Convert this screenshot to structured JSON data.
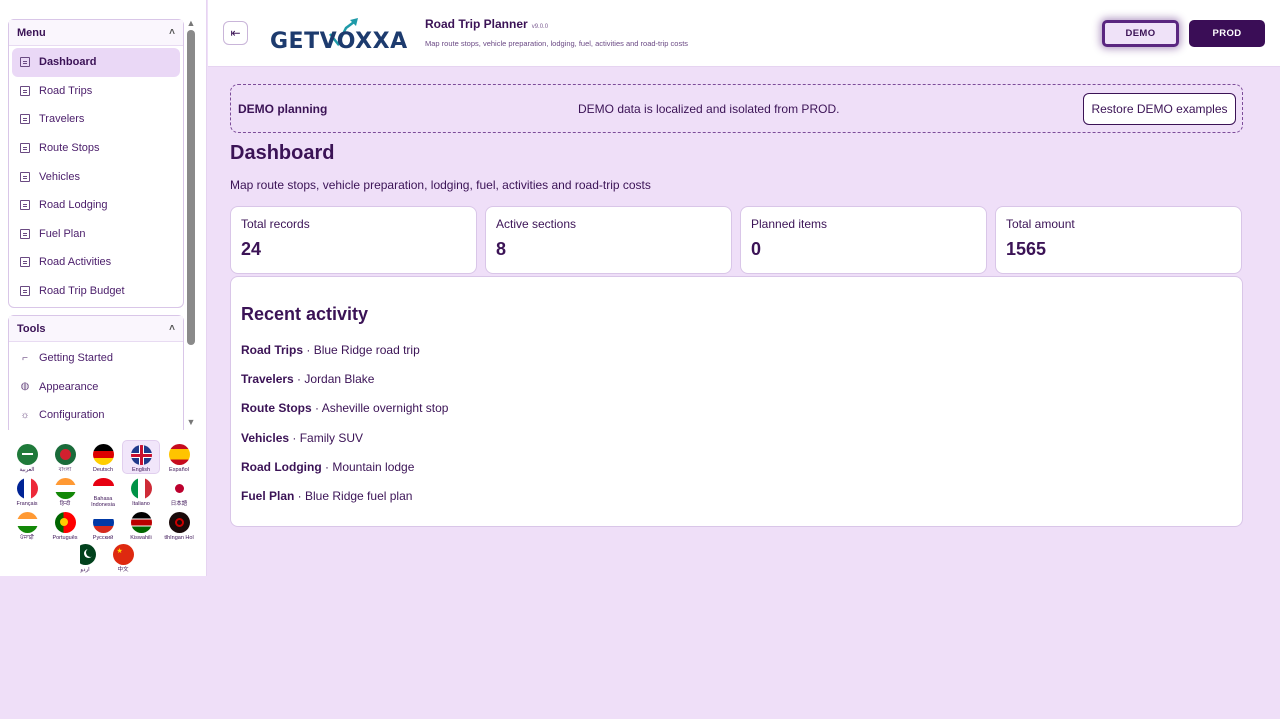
{
  "sidebar": {
    "menu": {
      "title": "Menu",
      "items": [
        {
          "label": "Dashboard",
          "active": true
        },
        {
          "label": "Road Trips"
        },
        {
          "label": "Travelers"
        },
        {
          "label": "Route Stops"
        },
        {
          "label": "Vehicles"
        },
        {
          "label": "Road Lodging"
        },
        {
          "label": "Fuel Plan"
        },
        {
          "label": "Road Activities"
        },
        {
          "label": "Road Trip Budget"
        }
      ]
    },
    "tools": {
      "title": "Tools",
      "items": [
        {
          "label": "Getting Started",
          "icon": "crop-icon"
        },
        {
          "label": "Appearance",
          "icon": "palette-icon"
        },
        {
          "label": "Configuration",
          "icon": "gear-icon"
        }
      ]
    },
    "languages": [
      {
        "label": "العربية",
        "flag": "saudi-arabia-flag-icon"
      },
      {
        "label": "বাংলা",
        "flag": "bangladesh-flag-icon"
      },
      {
        "label": "Deutsch",
        "flag": "germany-flag-icon"
      },
      {
        "label": "English",
        "flag": "uk-flag-icon",
        "active": true
      },
      {
        "label": "Español",
        "flag": "spain-flag-icon"
      },
      {
        "label": "Français",
        "flag": "france-flag-icon"
      },
      {
        "label": "हिन्दी",
        "flag": "india-flag-icon"
      },
      {
        "label": "Bahasa Indonesia",
        "flag": "indonesia-flag-icon"
      },
      {
        "label": "Italiano",
        "flag": "italy-flag-icon"
      },
      {
        "label": "日本語",
        "flag": "japan-flag-icon"
      },
      {
        "label": "ਪੰਜਾਬੀ",
        "flag": "india-flag-icon"
      },
      {
        "label": "Português",
        "flag": "portugal-flag-icon"
      },
      {
        "label": "Русский",
        "flag": "russia-flag-icon"
      },
      {
        "label": "Kiswahili",
        "flag": "kenya-flag-icon"
      },
      {
        "label": "tlhIngan Hol",
        "flag": "klingon-flag-icon"
      },
      {
        "label": "اردو",
        "flag": "pakistan-flag-icon"
      },
      {
        "label": "中文",
        "flag": "china-flag-icon"
      }
    ]
  },
  "header": {
    "logo_text": "GETVOXXA",
    "app_title": "Road Trip Planner",
    "version": "v9.0.0",
    "subtitle": "Map route stops, vehicle preparation, lodging, fuel, activities and road-trip costs",
    "env_demo": "DEMO",
    "env_prod": "PROD"
  },
  "banner": {
    "title": "DEMO planning",
    "text": "DEMO data is localized and isolated from PROD.",
    "button": "Restore DEMO examples"
  },
  "main": {
    "title": "Dashboard",
    "subtitle": "Map route stops, vehicle preparation, lodging, fuel, activities and road-trip costs",
    "cards": [
      {
        "label": "Total records",
        "value": "24"
      },
      {
        "label": "Active sections",
        "value": "8"
      },
      {
        "label": "Planned items",
        "value": "0"
      },
      {
        "label": "Total amount",
        "value": "1565"
      }
    ],
    "activity": {
      "title": "Recent activity",
      "rows": [
        {
          "section": "Road Trips",
          "item": "Blue Ridge road trip"
        },
        {
          "section": "Travelers",
          "item": "Jordan Blake"
        },
        {
          "section": "Route Stops",
          "item": "Asheville overnight stop"
        },
        {
          "section": "Vehicles",
          "item": "Family SUV"
        },
        {
          "section": "Road Lodging",
          "item": "Mountain lodge"
        },
        {
          "section": "Fuel Plan",
          "item": "Blue Ridge fuel plan"
        }
      ]
    }
  },
  "colors": {
    "accent": "#3b1356",
    "background": "#efdff8",
    "prod_button": "#3a0d56"
  }
}
